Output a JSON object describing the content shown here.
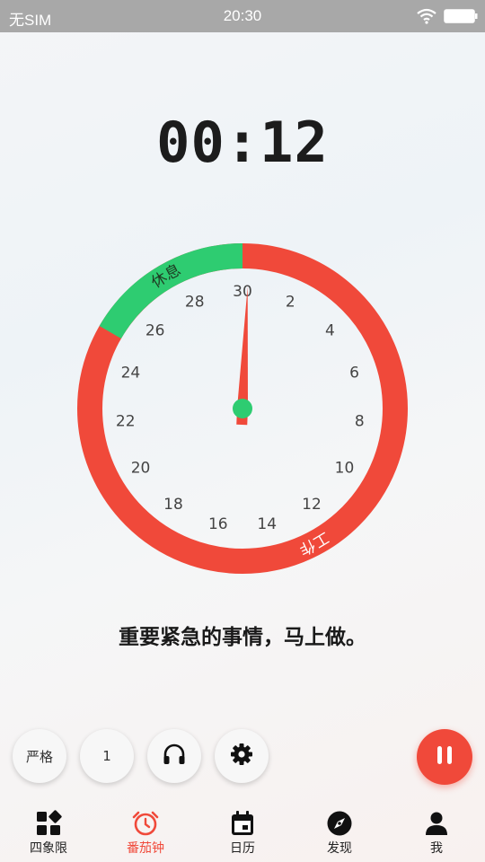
{
  "status_bar": {
    "carrier": "无SIM",
    "time": "20:30"
  },
  "timer": {
    "display": "00:12"
  },
  "dial": {
    "work_label": "工作",
    "rest_label": "休息",
    "ticks": [
      "30",
      "2",
      "4",
      "6",
      "8",
      "10",
      "12",
      "14",
      "16",
      "18",
      "20",
      "22",
      "24",
      "26",
      "28"
    ],
    "minutes_total": 30,
    "rest_minutes": 5,
    "hand_minutes": 0.2
  },
  "motto": "重要紧急的事情，马上做。",
  "controls": {
    "strict_label": "严格",
    "count_label": "1"
  },
  "tabs": [
    {
      "label": "四象限",
      "icon": "quadrant-icon"
    },
    {
      "label": "番茄钟",
      "icon": "alarm-clock-icon",
      "active": true
    },
    {
      "label": "日历",
      "icon": "calendar-icon"
    },
    {
      "label": "发现",
      "icon": "compass-icon"
    },
    {
      "label": "我",
      "icon": "person-icon"
    }
  ],
  "colors": {
    "work": "#f0493a",
    "rest": "#2ecc71",
    "center": "#2ecc71"
  }
}
